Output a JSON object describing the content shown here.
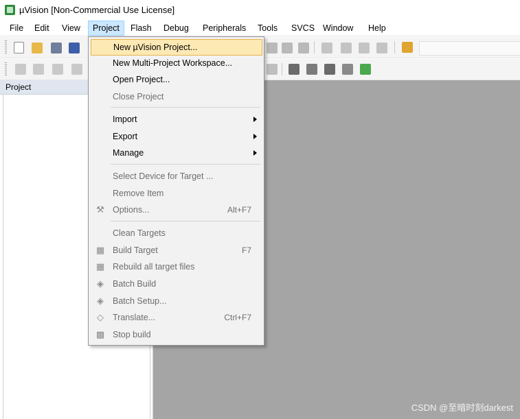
{
  "window": {
    "title": "µVision  [Non-Commercial Use License]"
  },
  "menubar": {
    "items": [
      "File",
      "Edit",
      "View",
      "Project",
      "Flash",
      "Debug",
      "Peripherals",
      "Tools",
      "SVCS",
      "Window",
      "Help"
    ],
    "active": "Project"
  },
  "project_panel": {
    "title": "Project"
  },
  "project_menu": {
    "items": [
      {
        "label": "New µVision Project...",
        "highlighted": true,
        "enabled": true
      },
      {
        "label": "New Multi-Project Workspace...",
        "enabled": true
      },
      {
        "label": "Open Project...",
        "enabled": true
      },
      {
        "label": "Close Project",
        "enabled": false
      },
      {
        "label": "Import",
        "enabled": true,
        "submenu": true
      },
      {
        "label": "Export",
        "enabled": true,
        "submenu": true
      },
      {
        "label": "Manage",
        "enabled": true,
        "submenu": true
      },
      {
        "label": "Select Device for Target ...",
        "enabled": false
      },
      {
        "label": "Remove Item",
        "enabled": false
      },
      {
        "label": "Options...",
        "shortcut": "Alt+F7",
        "enabled": false,
        "icon": "options-icon"
      },
      {
        "label": "Clean Targets",
        "enabled": false
      },
      {
        "label": "Build Target",
        "shortcut": "F7",
        "enabled": false,
        "icon": "build-icon"
      },
      {
        "label": "Rebuild all target files",
        "enabled": false,
        "icon": "rebuild-icon"
      },
      {
        "label": "Batch Build",
        "enabled": false,
        "icon": "batch-build-icon"
      },
      {
        "label": "Batch Setup...",
        "enabled": false,
        "icon": "batch-setup-icon"
      },
      {
        "label": "Translate...",
        "shortcut": "Ctrl+F7",
        "enabled": false,
        "icon": "translate-icon"
      },
      {
        "label": "Stop build",
        "enabled": false,
        "icon": "stop-build-icon"
      }
    ]
  },
  "watermark": "CSDN @至暗时刻darkest",
  "colors": {
    "menu_highlight_bg": "#fde9b4",
    "menu_highlight_border": "#e7b44d",
    "active_menu_bg": "#cce8ff",
    "workspace_gray": "#a5a5a5"
  }
}
